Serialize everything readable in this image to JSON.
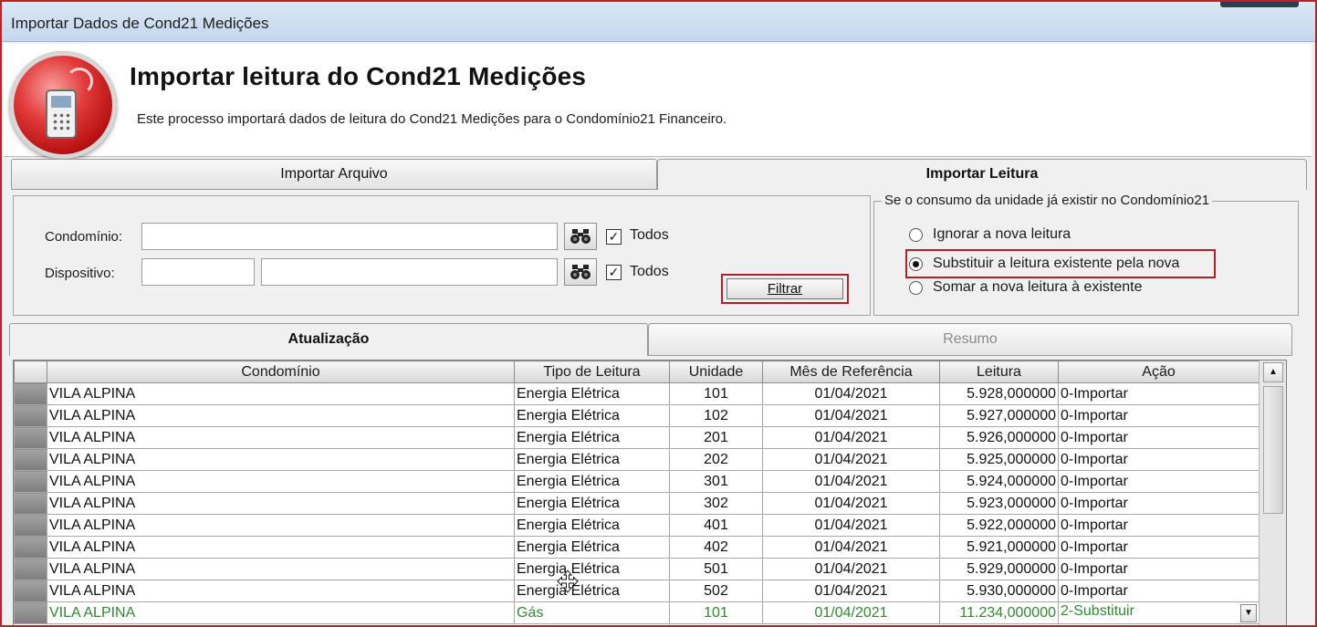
{
  "window": {
    "title": "Importar Dados de Cond21 Medições"
  },
  "header": {
    "title": "Importar leitura do Cond21 Medições",
    "subtitle": "Este processo importará dados de leitura do Cond21 Medições para o Condomínio21 Financeiro."
  },
  "top_tabs": [
    {
      "label": "Importar Arquivo",
      "active": false
    },
    {
      "label": "Importar Leitura",
      "active": true
    }
  ],
  "filters": {
    "condominio_label": "Condomínio:",
    "condominio_value": "",
    "dispositivo_label": "Dispositivo:",
    "dispositivo_code": "",
    "dispositivo_value": "",
    "todos_label": "Todos",
    "condominio_todos_checked": true,
    "dispositivo_todos_checked": true,
    "check_glyph": "✓",
    "filtrar_label": "Filtrar"
  },
  "options": {
    "legend": "Se o consumo da unidade já existir no Condomínio21",
    "items": [
      {
        "label": "Ignorar a nova leitura",
        "checked": false
      },
      {
        "label": "Substituir a leitura existente pela nova",
        "checked": true
      },
      {
        "label": "Somar a nova leitura à existente",
        "checked": false
      }
    ]
  },
  "lower_tabs": [
    {
      "label": "Atualização",
      "active": true
    },
    {
      "label": "Resumo",
      "active": false
    }
  ],
  "grid": {
    "columns": [
      "Condomínio",
      "Tipo de Leitura",
      "Unidade",
      "Mês de Referência",
      "Leitura",
      "Ação"
    ],
    "rows": [
      [
        "VILA ALPINA",
        "Energia Elétrica",
        "101",
        "01/04/2021",
        "5.928,000000",
        "0-Importar"
      ],
      [
        "VILA ALPINA",
        "Energia Elétrica",
        "102",
        "01/04/2021",
        "5.927,000000",
        "0-Importar"
      ],
      [
        "VILA ALPINA",
        "Energia Elétrica",
        "201",
        "01/04/2021",
        "5.926,000000",
        "0-Importar"
      ],
      [
        "VILA ALPINA",
        "Energia Elétrica",
        "202",
        "01/04/2021",
        "5.925,000000",
        "0-Importar"
      ],
      [
        "VILA ALPINA",
        "Energia Elétrica",
        "301",
        "01/04/2021",
        "5.924,000000",
        "0-Importar"
      ],
      [
        "VILA ALPINA",
        "Energia Elétrica",
        "302",
        "01/04/2021",
        "5.923,000000",
        "0-Importar"
      ],
      [
        "VILA ALPINA",
        "Energia Elétrica",
        "401",
        "01/04/2021",
        "5.922,000000",
        "0-Importar"
      ],
      [
        "VILA ALPINA",
        "Energia Elétrica",
        "402",
        "01/04/2021",
        "5.921,000000",
        "0-Importar"
      ],
      [
        "VILA ALPINA",
        "Energia Elétrica",
        "501",
        "01/04/2021",
        "5.929,000000",
        "0-Importar"
      ],
      [
        "VILA ALPINA",
        "Energia Elétrica",
        "502",
        "01/04/2021",
        "5.930,000000",
        "0-Importar"
      ],
      [
        "VILA ALPINA",
        "Gás",
        "101",
        "01/04/2021",
        "11.234,000000",
        "2-Substituir"
      ]
    ],
    "highlight_color": "#2f8a2f"
  },
  "icons": {
    "binoculars": "binoculars-icon",
    "scroll_up": "scroll-up-arrow-icon",
    "dropdown": "dropdown-arrow-icon",
    "scroll_up_glyph": "▲",
    "dropdown_glyph": "▼"
  },
  "colors": {
    "annotation_red": "#b41e28",
    "title_bar": "#c4d7ec"
  }
}
